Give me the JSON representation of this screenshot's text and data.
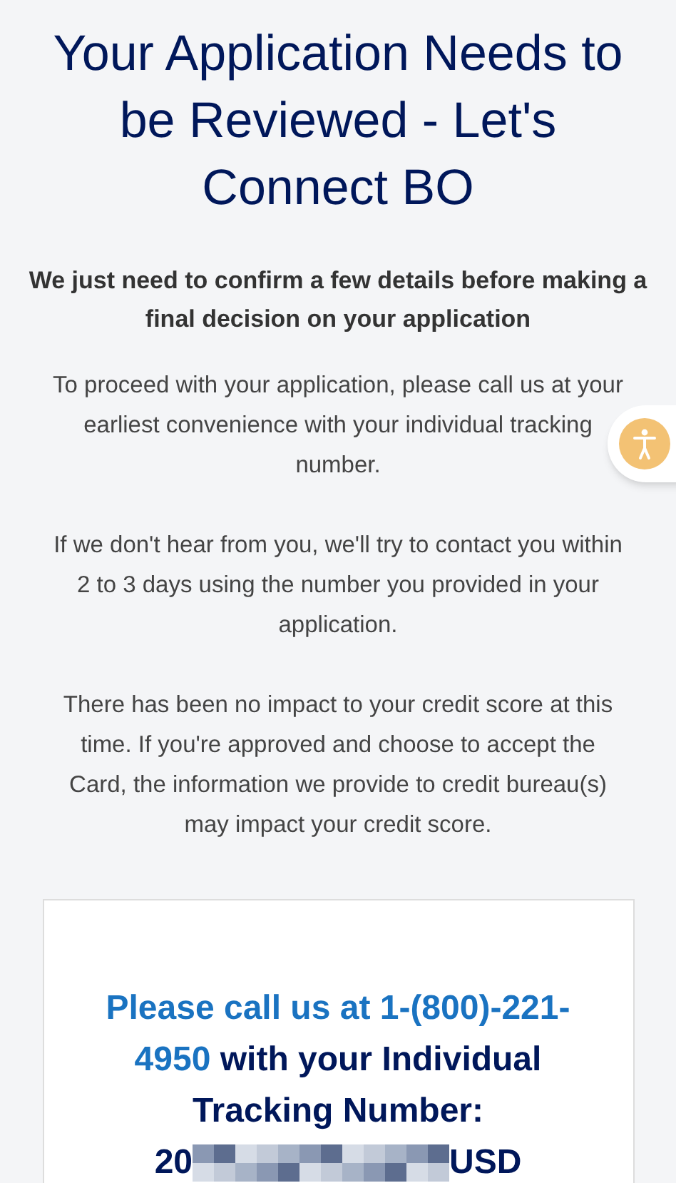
{
  "title": "Your Application Needs to be Reviewed - Let's Connect BO",
  "subtitle": "We just need to confirm a few details before making a final decision on your application",
  "paragraphs": [
    "To proceed with your application, please call us at your earliest convenience with your individual tracking number.",
    "If we don't hear from you, we'll try to contact you within 2 to 3 days using the number you provided in your application.",
    "There has been no impact to your credit score at this time. If you're approved and choose to accept the Card, the information we provide to credit bureau(s) may impact your credit score."
  ],
  "card": {
    "call_text": "Please call us at 1-(800)-221-4950",
    "call_rest": "with your Individual Tracking Number:",
    "tracking_start": "20",
    "tracking_end": "USD",
    "tracking_redacted": true
  }
}
